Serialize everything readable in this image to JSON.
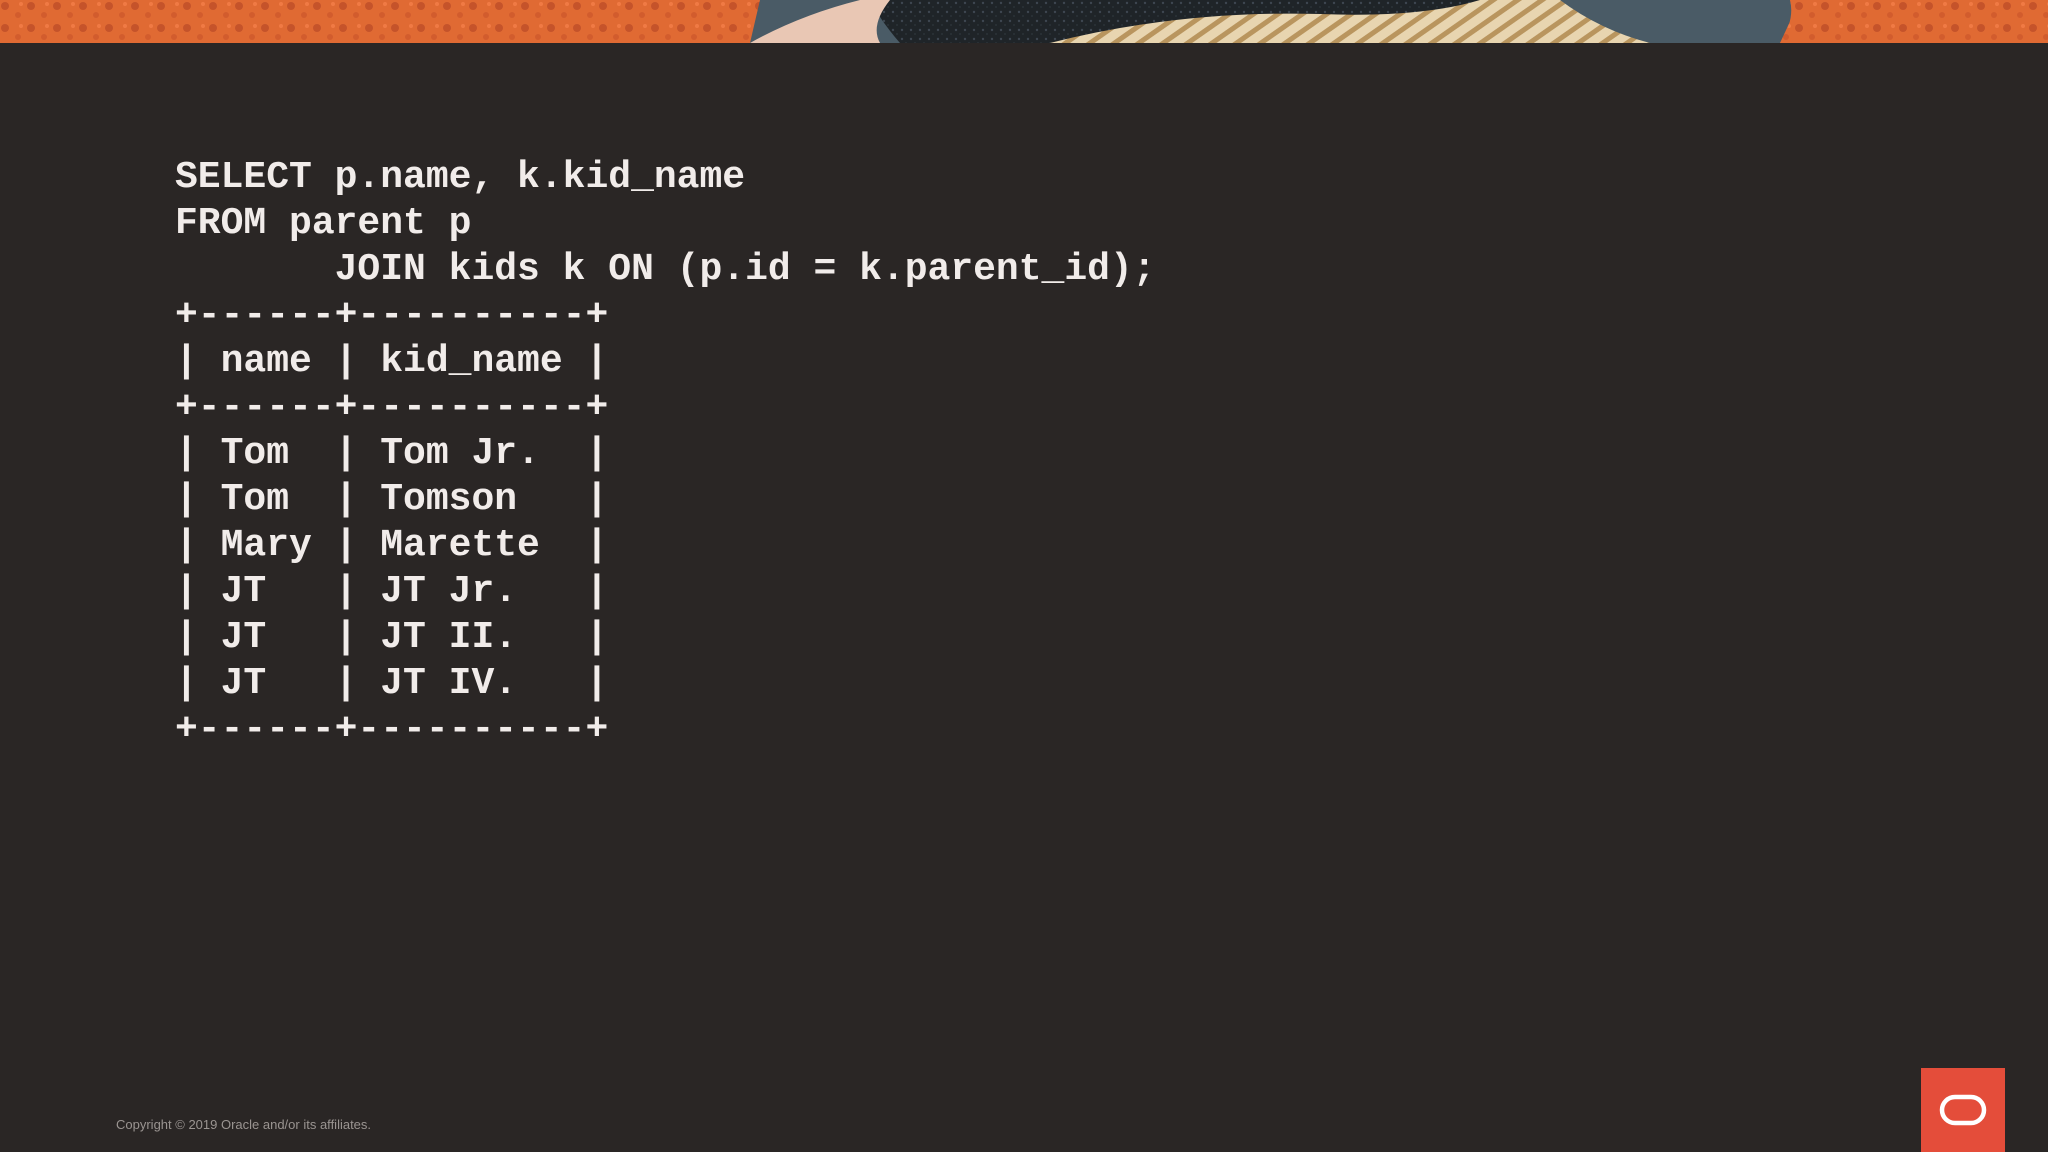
{
  "slide": {
    "code_lines": [
      "SELECT p.name, k.kid_name",
      "FROM parent p",
      "       JOIN kids k ON (p.id = k.parent_id);",
      "+------+----------+",
      "| name | kid_name |",
      "+------+----------+",
      "| Tom  | Tom Jr.  |",
      "| Tom  | Tomson   |",
      "| Mary | Marette  |",
      "| JT   | JT Jr.   |",
      "| JT   | JT II.   |",
      "| JT   | JT IV.   |",
      "+------+----------+"
    ],
    "copyright": "Copyright © 2019 Oracle and/or its affiliates.",
    "logo_icon": "oracle-logo-icon"
  },
  "colors": {
    "background": "#2a2625",
    "banner_orange": "#e06a33",
    "banner_dark": "#1f2428",
    "banner_slate": "#4a5b66",
    "banner_cream": "#e8d5b0",
    "code_text": "#f1ecea",
    "logo_red": "#e44d3a"
  }
}
